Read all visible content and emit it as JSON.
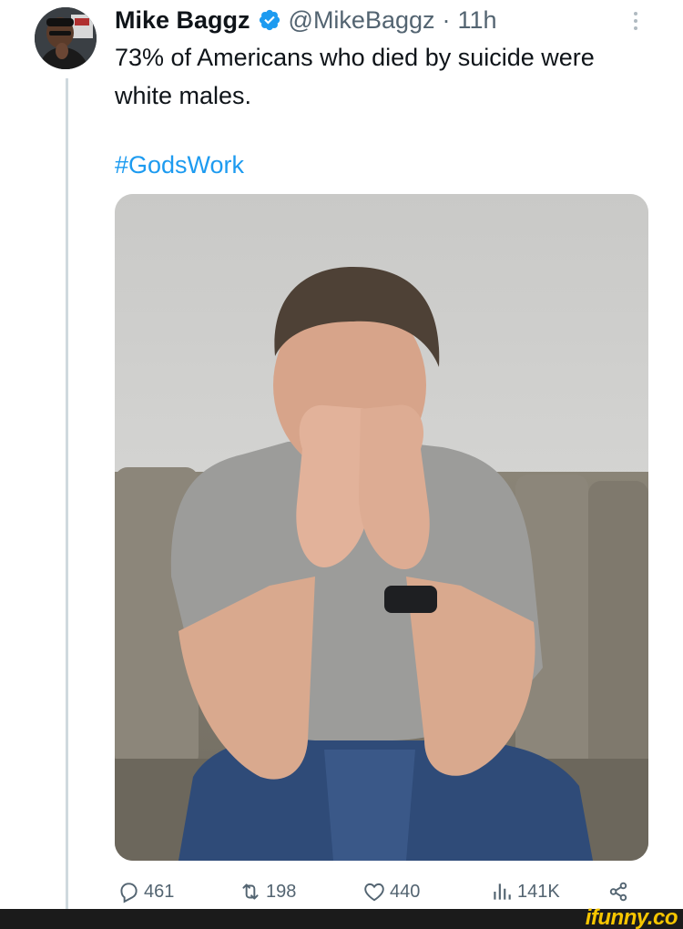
{
  "tweet": {
    "display_name": "Mike Baggz",
    "handle": "@MikeBaggz",
    "separator": "·",
    "time": "11h",
    "text": "73% of Americans who died by suicide were white males.",
    "hashtag": "#GodsWork"
  },
  "actions": {
    "replies": "461",
    "retweets": "198",
    "likes": "440",
    "views": "141K"
  },
  "icons": {
    "verified": "verified-badge-icon",
    "more": "more-options-icon",
    "reply": "reply-icon",
    "retweet": "retweet-icon",
    "like": "heart-icon",
    "views": "views-chart-icon",
    "share": "share-icon"
  },
  "colors": {
    "accent": "#1d9bf0",
    "secondary_text": "#536471",
    "watermark": "#f7c600"
  },
  "watermark": "ifunny.co"
}
